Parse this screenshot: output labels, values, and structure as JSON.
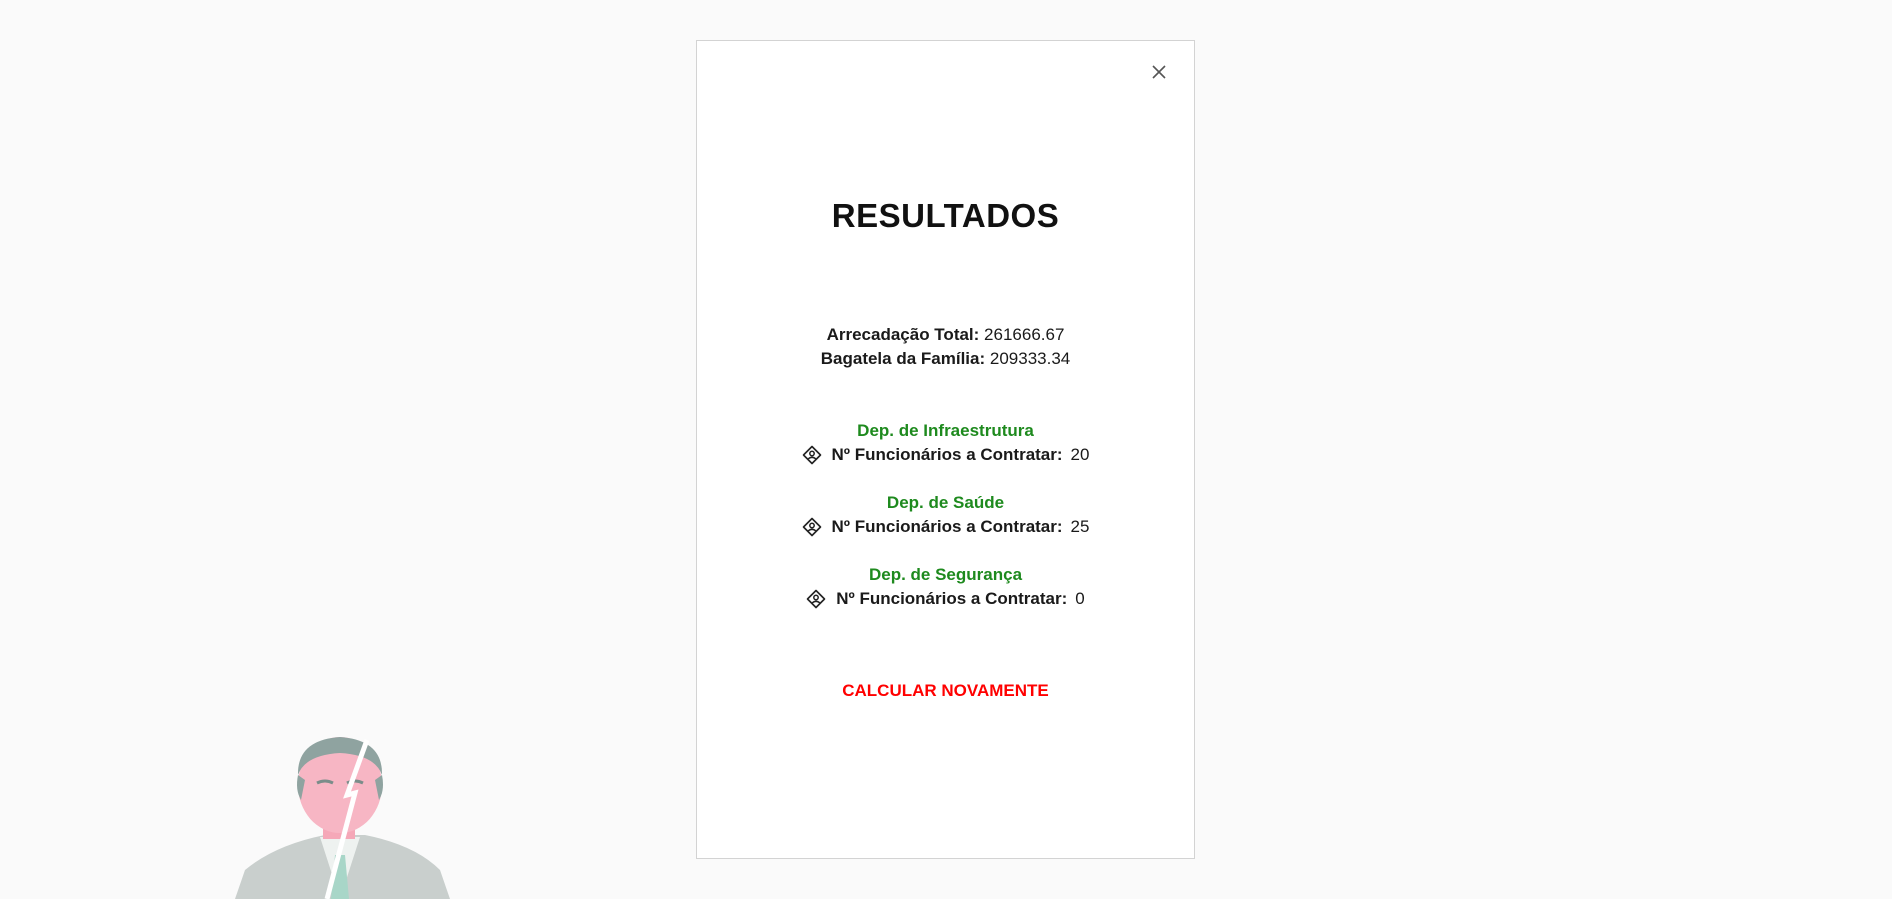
{
  "modal": {
    "title": "RESULTADOS",
    "close_icon": "close-icon",
    "totals": [
      {
        "label": "Arrecadação Total:",
        "value": "261666.67"
      },
      {
        "label": "Bagatela da Família:",
        "value": "209333.34"
      }
    ],
    "departments": [
      {
        "name": "Dep. de Infraestrutura",
        "label": "Nº Funcionários a Contratar:",
        "value": "20",
        "icon": "person-badge-icon"
      },
      {
        "name": "Dep. de Saúde",
        "label": "Nº Funcionários a Contratar:",
        "value": "25",
        "icon": "person-badge-icon"
      },
      {
        "name": "Dep. de Segurança",
        "label": "Nº Funcionários a Contratar:",
        "value": "0",
        "icon": "person-badge-icon"
      }
    ],
    "recalculate_label": "CALCULAR NOVAMENTE"
  },
  "colors": {
    "department_name": "#1e8a1e",
    "recalculate": "#ff0000",
    "background": "#fafafa"
  }
}
